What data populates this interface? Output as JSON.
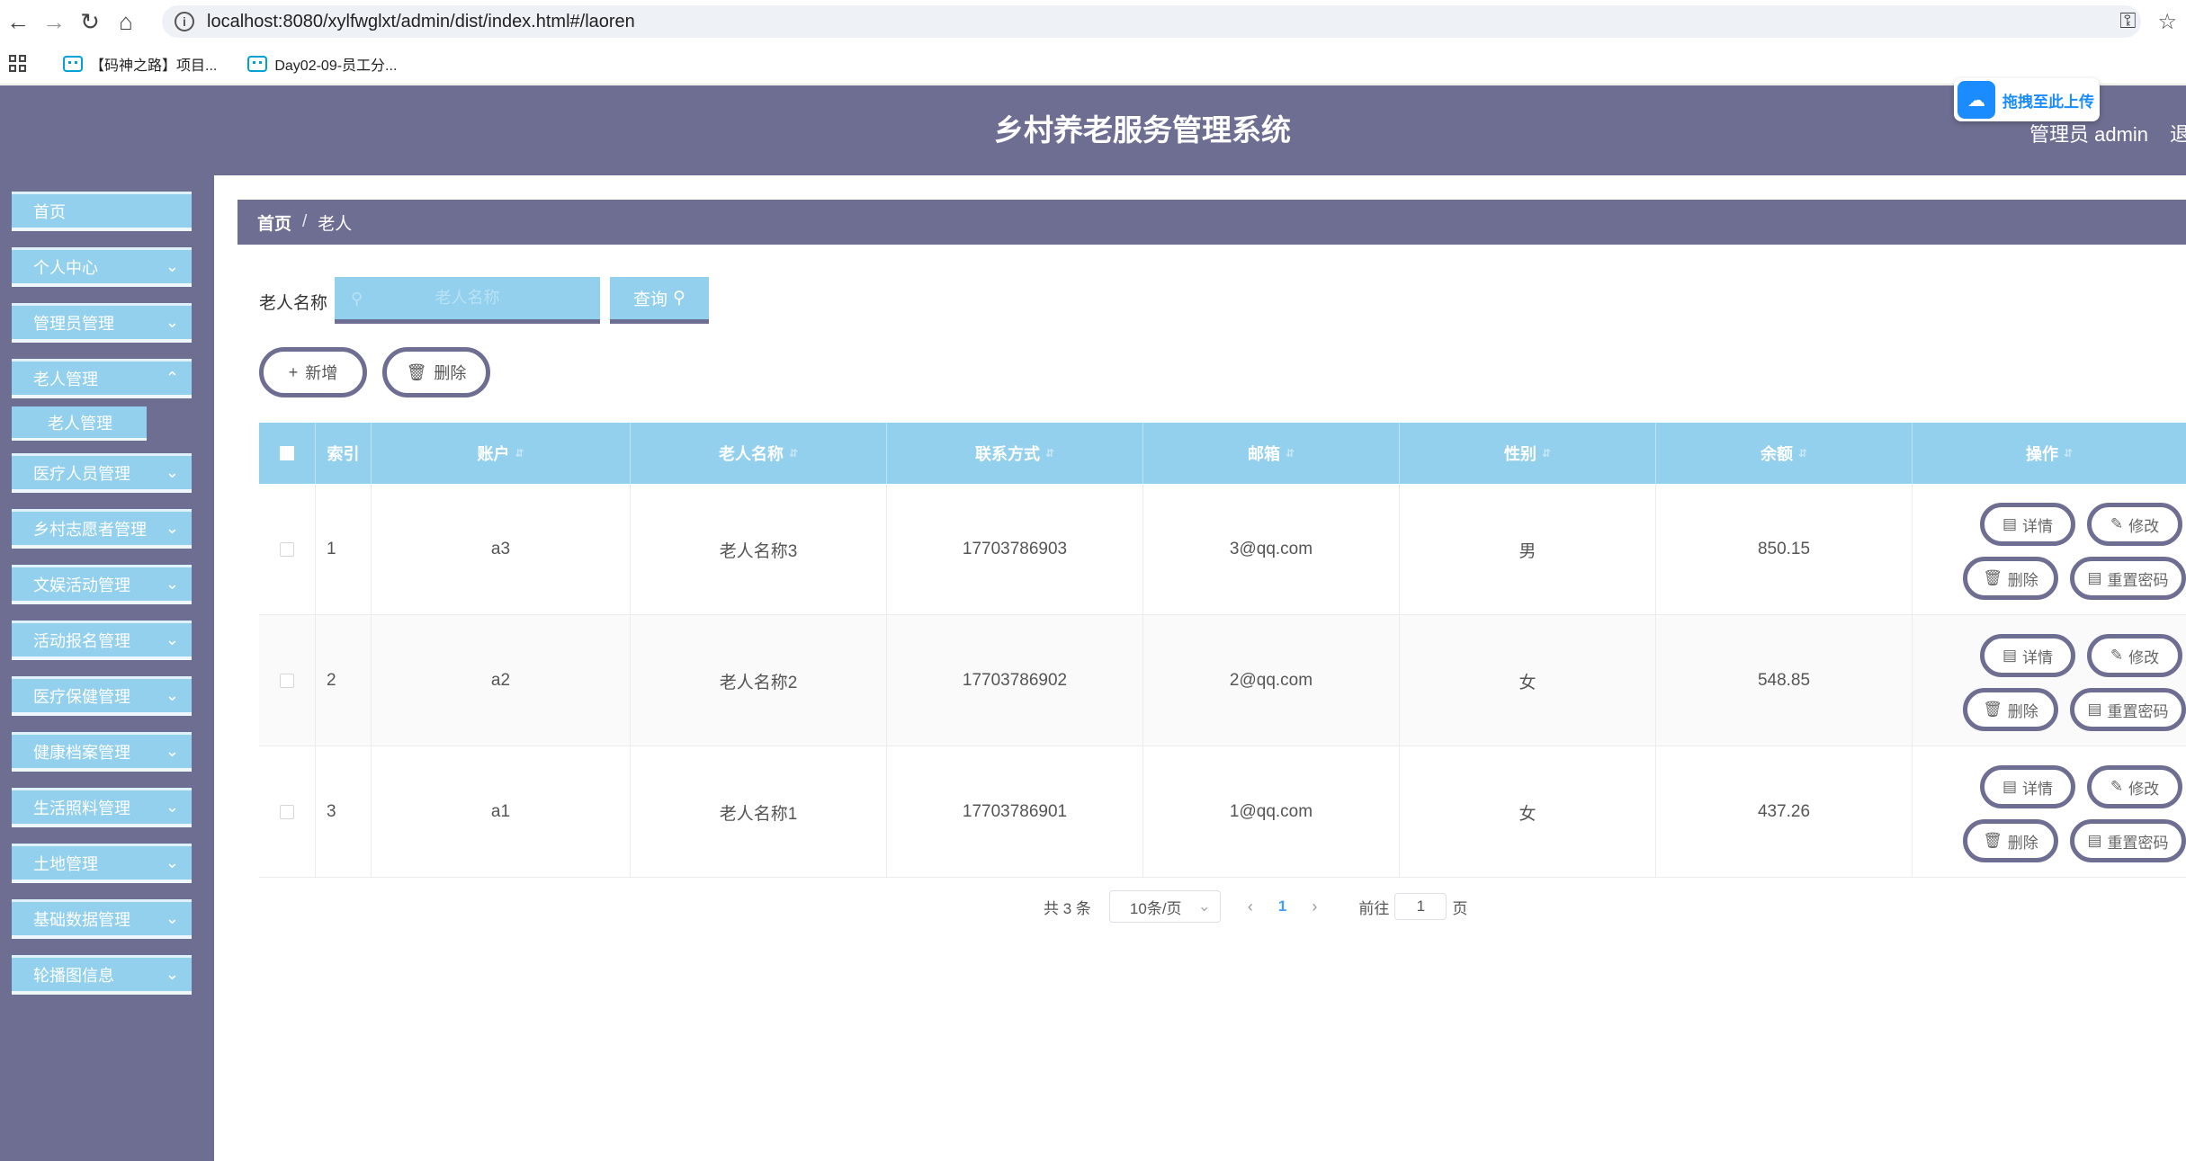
{
  "browser": {
    "url": "localhost:8080/xylfwglxt/admin/dist/index.html#/laoren",
    "bookmarks": [
      "【码神之路】项目...",
      "Day02-09-员工分..."
    ]
  },
  "header": {
    "title": "乡村养老服务管理系统",
    "admin_label": "管理员 admin",
    "logout_label": "退",
    "upload_label": "拖拽至此上传"
  },
  "sidebar": {
    "items": [
      {
        "label": "首页"
      },
      {
        "label": "个人中心"
      },
      {
        "label": "管理员管理"
      },
      {
        "label": "老人管理"
      },
      {
        "label": "医疗人员管理"
      },
      {
        "label": "乡村志愿者管理"
      },
      {
        "label": "文娱活动管理"
      },
      {
        "label": "活动报名管理"
      },
      {
        "label": "医疗保健管理"
      },
      {
        "label": "健康档案管理"
      },
      {
        "label": "生活照料管理"
      },
      {
        "label": "土地管理"
      },
      {
        "label": "基础数据管理"
      },
      {
        "label": "轮播图信息"
      }
    ],
    "sub_item": "老人管理"
  },
  "breadcrumb": {
    "home": "首页",
    "sep": "/",
    "current": "老人"
  },
  "search": {
    "label": "老人名称",
    "placeholder": "老人名称",
    "button": "查询"
  },
  "actions": {
    "add": "新增",
    "delete": "删除"
  },
  "table": {
    "headers": [
      "索引",
      "账户",
      "老人名称",
      "联系方式",
      "邮箱",
      "性别",
      "余额",
      "操作"
    ],
    "rows": [
      {
        "index": "1",
        "account": "a3",
        "name": "老人名称3",
        "phone": "17703786903",
        "email": "3@qq.com",
        "gender": "男",
        "balance": "850.15"
      },
      {
        "index": "2",
        "account": "a2",
        "name": "老人名称2",
        "phone": "17703786902",
        "email": "2@qq.com",
        "gender": "女",
        "balance": "548.85"
      },
      {
        "index": "3",
        "account": "a1",
        "name": "老人名称1",
        "phone": "17703786901",
        "email": "1@qq.com",
        "gender": "女",
        "balance": "437.26"
      }
    ],
    "ops": {
      "detail": "详情",
      "edit": "修改",
      "delete": "删除",
      "reset": "重置密码"
    }
  },
  "pagination": {
    "total": "共 3 条",
    "page_size": "10条/页",
    "current": "1",
    "goto": "前往",
    "goto_value": "1",
    "page_unit": "页"
  }
}
